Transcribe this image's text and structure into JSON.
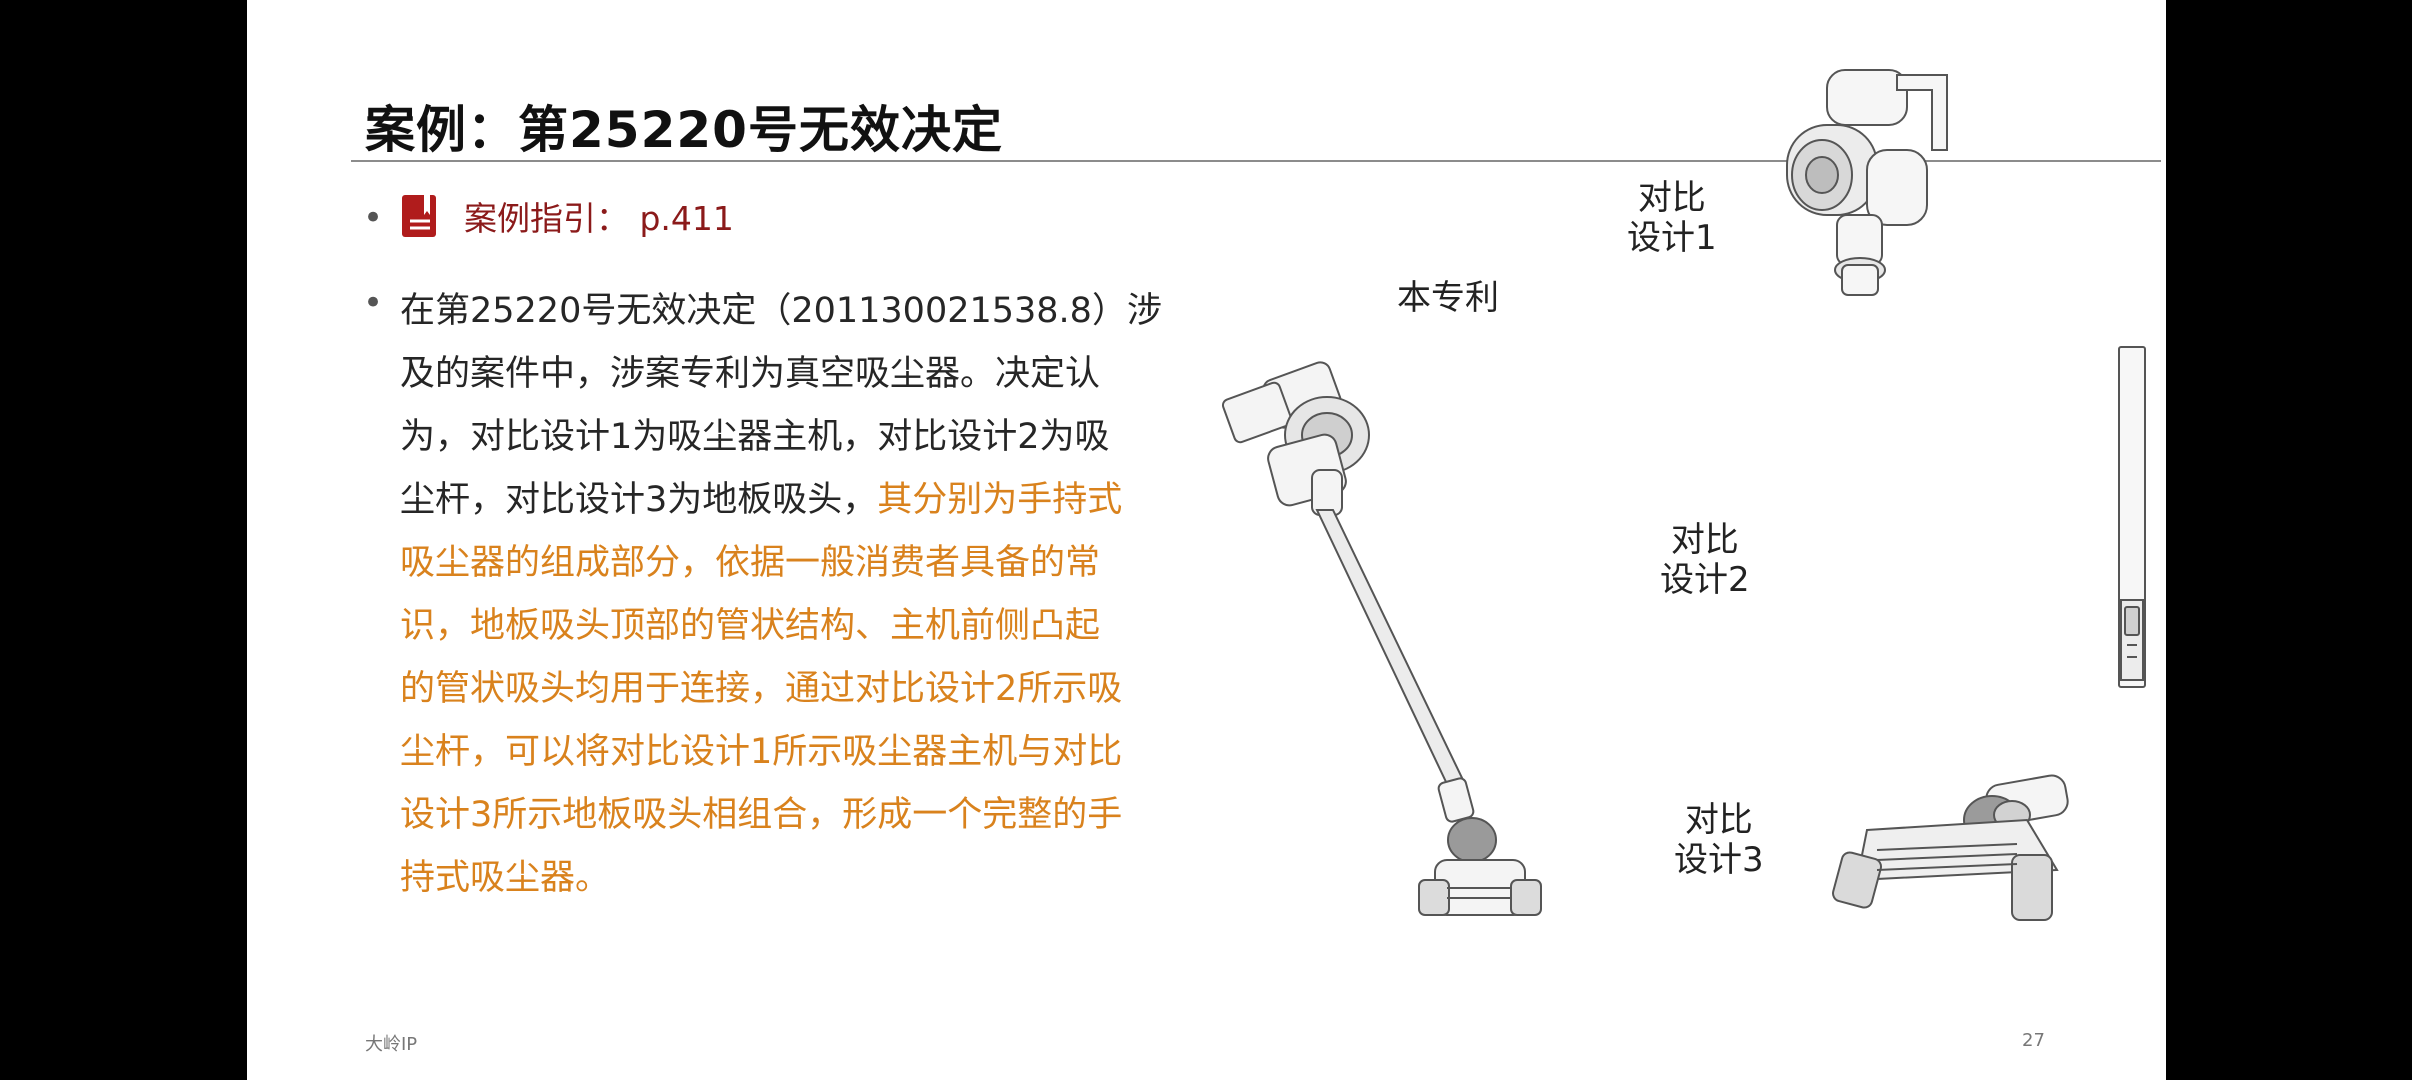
{
  "slide": {
    "title": "案例：第25220号无效决定",
    "guide": {
      "icon": "book-icon",
      "label": "案例指引： p.411"
    },
    "bullet_lines": [
      {
        "segments": [
          {
            "text": "在第25220号无效决定（201130021538.8）涉",
            "highlight": false
          }
        ]
      },
      {
        "segments": [
          {
            "text": "及的案件中，涉案专利为真空吸尘器。决定认",
            "highlight": false
          }
        ]
      },
      {
        "segments": [
          {
            "text": "为，对比设计1为吸尘器主机，对比设计2为吸",
            "highlight": false
          }
        ]
      },
      {
        "segments": [
          {
            "text": "尘杆，对比设计3为地板吸头，",
            "highlight": false
          },
          {
            "text": "其分别为手持式",
            "highlight": true
          }
        ]
      },
      {
        "segments": [
          {
            "text": "吸尘器的组成部分，依据一般消费者具备的常",
            "highlight": true
          }
        ]
      },
      {
        "segments": [
          {
            "text": "识，地板吸头顶部的管状结构、主机前侧凸起",
            "highlight": true
          }
        ]
      },
      {
        "segments": [
          {
            "text": "的管状吸头均用于连接，通过对比设计2所示吸",
            "highlight": true
          }
        ]
      },
      {
        "segments": [
          {
            "text": "尘杆，可以将对比设计1所示吸尘器主机与对比",
            "highlight": true
          }
        ]
      },
      {
        "segments": [
          {
            "text": "设计3所示地板吸头相组合，形成一个完整的手",
            "highlight": true
          }
        ]
      },
      {
        "segments": [
          {
            "text": "持式吸尘器。",
            "highlight": true
          }
        ]
      }
    ],
    "figures": {
      "this_patent_label": "本专利",
      "design1_label_l1": "对比",
      "design1_label_l2": "设计1",
      "design2_label_l1": "对比",
      "design2_label_l2": "设计2",
      "design3_label_l1": "对比",
      "design3_label_l2": "设计3"
    },
    "footer": {
      "brand": "大岭IP",
      "page_number": "27"
    },
    "colors": {
      "highlight": "#d9821d",
      "guide": "#8b1a1a",
      "frame": "#000000"
    }
  }
}
